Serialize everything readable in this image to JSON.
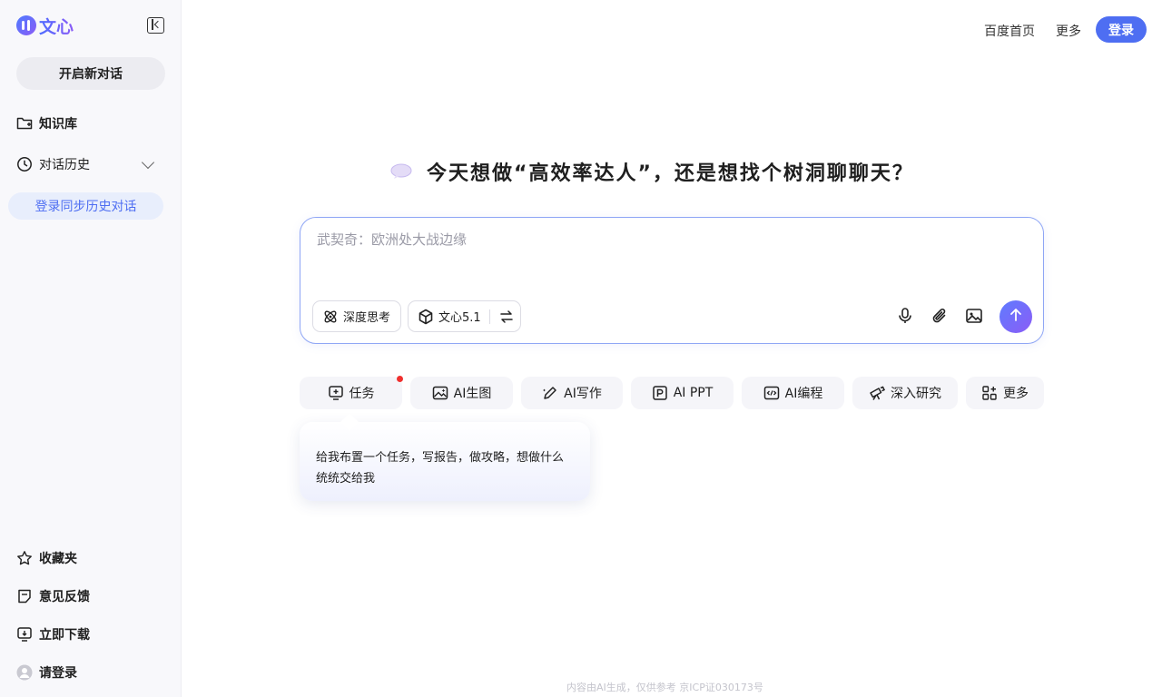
{
  "sidebar": {
    "logo_text": "文心",
    "new_chat": "开启新对话",
    "knowledge_base": "知识库",
    "history": "对话历史",
    "sync_history": "登录同步历史对话",
    "favorites": "收藏夹",
    "feedback": "意见反馈",
    "download": "立即下载",
    "login": "请登录"
  },
  "header": {
    "baidu_home": "百度首页",
    "more": "更多",
    "login": "登录"
  },
  "main": {
    "headline": "今天想做“高效率达人”，还是想找个树洞聊聊天？",
    "input_placeholder": "武契奇：欧洲处大战边缘",
    "deep_think": "深度思考",
    "model": "文心5.1"
  },
  "quick_actions": [
    {
      "label": "任务",
      "icon": "task-icon"
    },
    {
      "label": "AI生图",
      "icon": "image-gen-icon"
    },
    {
      "label": "AI写作",
      "icon": "pen-icon"
    },
    {
      "label": "AI PPT",
      "icon": "ppt-icon"
    },
    {
      "label": "AI编程",
      "icon": "code-icon"
    },
    {
      "label": "深入研究",
      "icon": "telescope-icon"
    },
    {
      "label": "更多",
      "icon": "apps-icon"
    }
  ],
  "tooltip": {
    "text": "给我布置一个任务，写报告，做攻略，想做什么统统交给我"
  },
  "footer": {
    "text": "内容由AI生成，仅供参考  京ICP证030173号"
  },
  "colors": {
    "accent": "#4e6ef2",
    "notification_dot": "#f0302e"
  }
}
